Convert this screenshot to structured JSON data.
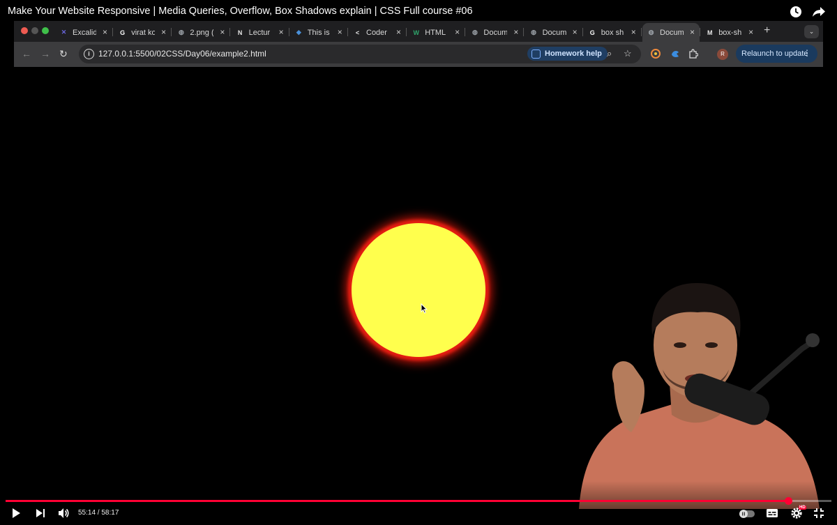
{
  "video": {
    "title": "Make Your Website Responsive | Media Queries, Overflow, Box Shadows explain | CSS Full course #06",
    "current_time": "55:14",
    "separator": " / ",
    "duration": "58:17",
    "progress": 0.9477,
    "hd_badge": "HD"
  },
  "browser": {
    "tabs": [
      {
        "label": "Excalid",
        "favicon": "excalidraw-icon",
        "color": "#6965db",
        "glyph": "✕"
      },
      {
        "label": "virat ko",
        "favicon": "google-icon",
        "color": "#ffffff",
        "glyph": "G"
      },
      {
        "label": "2.png (",
        "favicon": "globe-icon",
        "color": "#9aa0a6",
        "glyph": "◍"
      },
      {
        "label": "Lectur",
        "favicon": "notion-icon",
        "color": "#e8e8e8",
        "glyph": "N"
      },
      {
        "label": "This is",
        "favicon": "diamond-icon",
        "color": "#4a90d9",
        "glyph": "◆"
      },
      {
        "label": "Coder",
        "favicon": "coder-icon",
        "color": "#e8e8e8",
        "glyph": "<"
      },
      {
        "label": "HTML",
        "favicon": "webflow-icon",
        "color": "#2ea56b",
        "glyph": "W"
      },
      {
        "label": "Docum",
        "favicon": "globe-icon",
        "color": "#9aa0a6",
        "glyph": "◍"
      },
      {
        "label": "Docum",
        "favicon": "globe-icon",
        "color": "#9aa0a6",
        "glyph": "◍"
      },
      {
        "label": "box sh",
        "favicon": "google-icon",
        "color": "#ffffff",
        "glyph": "G"
      },
      {
        "label": "Docum",
        "favicon": "globe-icon",
        "color": "#9aa0a6",
        "glyph": "◍"
      },
      {
        "label": "box-sh",
        "favicon": "medium-icon",
        "color": "#e8e8e8",
        "glyph": "M"
      }
    ],
    "active_tab_index": 10,
    "url": "127.0.0.1:5500/02CSS/Day06/example2.html",
    "homework_help": "Homework help",
    "relaunch": "Relaunch to update",
    "profile_initial": "R"
  },
  "page": {
    "circle_color": "#ffff4d",
    "shadow_color": "#e61e12"
  }
}
